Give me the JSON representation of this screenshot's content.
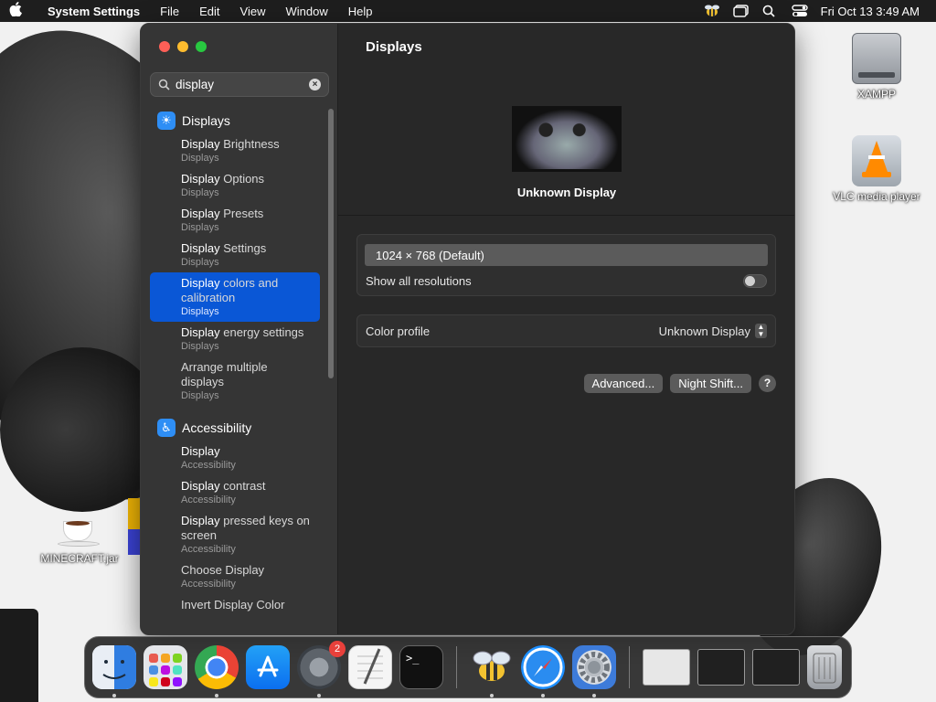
{
  "menubar": {
    "apple_icon": "apple-logo",
    "app_name": "System Settings",
    "menus": [
      "File",
      "Edit",
      "View",
      "Window",
      "Help"
    ],
    "clock": "Fri Oct 13  3:49 AM",
    "status_icons": [
      "bee-icon",
      "window-icon",
      "search-icon",
      "control-center-icon"
    ]
  },
  "desktop": {
    "icons": [
      {
        "label": "XAMPP",
        "icon": "drive-icon"
      },
      {
        "label": "VLC media player",
        "icon": "vlc-icon"
      },
      {
        "label": "MINECRAFT.jar",
        "icon": "java-cup-icon"
      }
    ]
  },
  "window": {
    "search": {
      "value": "display"
    },
    "sidebar": {
      "sections": [
        {
          "title": "Displays",
          "icon": "sun-icon",
          "results": [
            {
              "match": "Display",
              "rest": " Brightness",
              "sub": "Displays"
            },
            {
              "match": "Display",
              "rest": " Options",
              "sub": "Displays"
            },
            {
              "match": "Display",
              "rest": " Presets",
              "sub": "Displays"
            },
            {
              "match": "Display",
              "rest": " Settings",
              "sub": "Displays"
            },
            {
              "match": "Display",
              "rest": " colors and calibration",
              "sub": "Displays"
            },
            {
              "match": "Display",
              "rest": " energy settings",
              "sub": "Displays"
            },
            {
              "match": "",
              "rest": "Arrange multiple displays",
              "sub": "Displays"
            }
          ]
        },
        {
          "title": "Accessibility",
          "icon": "accessibility-icon",
          "results": [
            {
              "match": "Display",
              "rest": "",
              "sub": "Accessibility"
            },
            {
              "match": "Display",
              "rest": " contrast",
              "sub": "Accessibility"
            },
            {
              "match": "Display",
              "rest": " pressed keys on screen",
              "sub": "Accessibility"
            },
            {
              "match": "",
              "rest": "Choose Display",
              "sub": "Accessibility"
            },
            {
              "match": "",
              "rest": "Invert Display Color",
              "sub": ""
            }
          ]
        }
      ],
      "selected": "Display colors and calibration"
    },
    "content": {
      "title": "Displays",
      "display_name": "Unknown Display",
      "resolution": "1024 × 768 (Default)",
      "show_all_label": "Show all resolutions",
      "show_all_on": false,
      "color_profile_label": "Color profile",
      "color_profile_value": "Unknown Display",
      "buttons": {
        "advanced": "Advanced...",
        "night_shift": "Night Shift...",
        "help": "?"
      }
    }
  },
  "dock": {
    "apps": [
      "Finder",
      "Launchpad",
      "Google Chrome",
      "App Store",
      "System Preferences",
      "TextEdit",
      "Terminal",
      "Bee",
      "Safari",
      "System Settings"
    ],
    "sysprefs_badge": "2"
  },
  "colors": {
    "accent": "#0a57d6",
    "window_bg": "#282828",
    "sidebar_bg": "#353535"
  }
}
